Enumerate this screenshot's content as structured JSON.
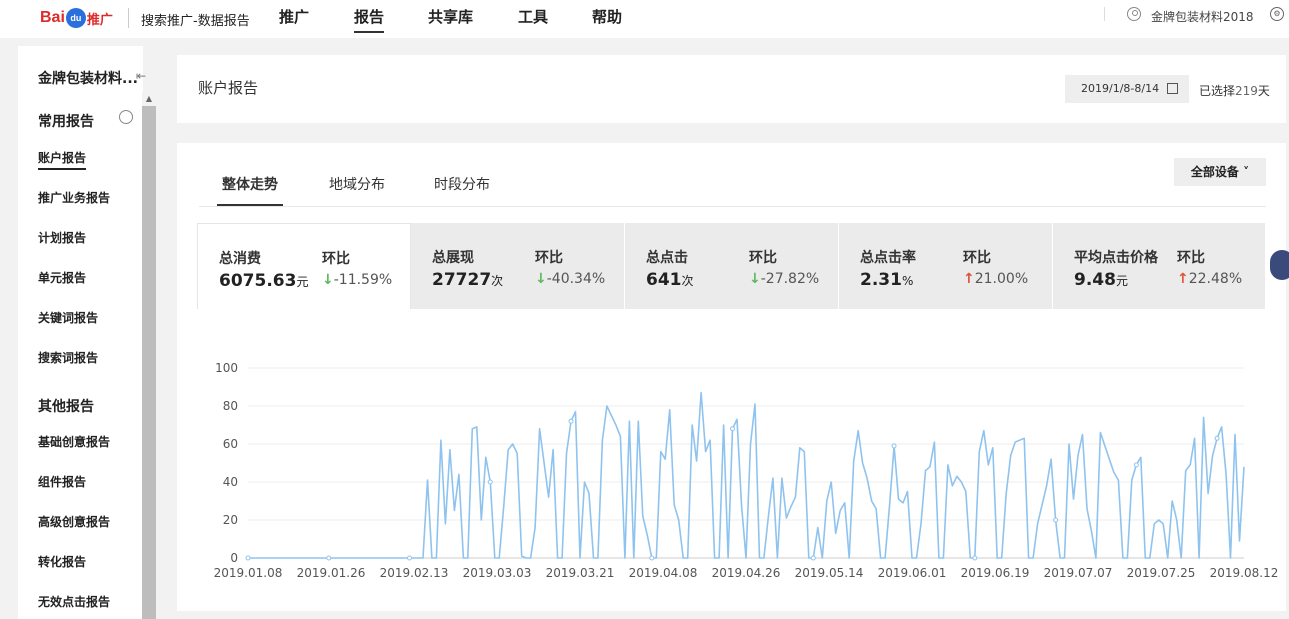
{
  "header": {
    "logo_bai": "Bai",
    "logo_du": "du",
    "logo_suffix": "推广",
    "app_title": "搜索推广-数据报告",
    "nav": [
      "推广",
      "报告",
      "共享库",
      "工具",
      "帮助"
    ],
    "active_nav": "报告",
    "user_name": "金牌包装材料2018"
  },
  "sidebar": {
    "account": "金牌包装材料...",
    "group_common": "常用报告",
    "common_items": [
      "账户报告",
      "推广业务报告",
      "计划报告",
      "单元报告",
      "关键词报告",
      "搜索词报告"
    ],
    "group_other": "其他报告",
    "other_items": [
      "基础创意报告",
      "组件报告",
      "高级创意报告",
      "转化报告",
      "无效点击报告"
    ]
  },
  "report": {
    "title": "账户报告",
    "date_range": "2019/1/8-8/14",
    "selected_prefix": "已选择",
    "selected_days": "219",
    "selected_suffix": "天"
  },
  "tabs": [
    "整体走势",
    "地域分布",
    "时段分布"
  ],
  "device_filter": "全部设备",
  "metrics": [
    {
      "label": "总消费",
      "value": "6075.63",
      "unit": "元",
      "cmp_label": "环比",
      "cmp": "-11.59%",
      "dir": "down"
    },
    {
      "label": "总展现",
      "value": "27727",
      "unit": "次",
      "cmp_label": "环比",
      "cmp": "-40.34%",
      "dir": "down"
    },
    {
      "label": "总点击",
      "value": "641",
      "unit": "次",
      "cmp_label": "环比",
      "cmp": "-27.82%",
      "dir": "down"
    },
    {
      "label": "总点击率",
      "value": "2.31",
      "unit": "%",
      "cmp_label": "环比",
      "cmp": "21.00%",
      "dir": "up"
    },
    {
      "label": "平均点击价格",
      "value": "9.48",
      "unit": "元",
      "cmp_label": "环比",
      "cmp": "22.48%",
      "dir": "up"
    }
  ],
  "colors": {
    "line": "#8fc3ef",
    "down_arrow": "#5cb85c",
    "up_arrow": "#e0533a"
  },
  "chart_data": {
    "type": "line",
    "ylim": [
      0,
      100
    ],
    "yticks": [
      0,
      20,
      40,
      60,
      80,
      100
    ],
    "xtick_labels": [
      "2019.01.08",
      "2019.01.26",
      "2019.02.13",
      "2019.03.03",
      "2019.03.21",
      "2019.04.08",
      "2019.04.26",
      "2019.05.14",
      "2019.06.01",
      "2019.06.19",
      "2019.07.07",
      "2019.07.25",
      "2019.08.12"
    ],
    "series": [
      {
        "values": [
          0,
          0,
          0,
          0,
          0,
          0,
          0,
          0,
          0,
          0,
          0,
          0,
          0,
          0,
          0,
          0,
          0,
          0,
          0,
          0,
          0,
          0,
          0,
          0,
          0,
          0,
          0,
          0,
          0,
          0,
          0,
          0,
          0,
          0,
          0,
          0,
          0,
          0,
          0,
          0,
          41,
          0,
          0,
          62,
          18,
          57,
          25,
          44,
          0,
          0,
          68,
          69,
          20,
          53,
          40,
          0,
          0,
          27,
          57,
          60,
          55,
          1,
          0,
          0,
          16,
          68,
          50,
          32,
          57,
          0,
          0,
          55,
          72,
          77,
          0,
          40,
          34,
          0,
          0,
          62,
          80,
          75,
          70,
          64,
          0,
          72,
          0,
          72,
          22,
          12,
          0,
          0,
          56,
          52,
          78,
          28,
          20,
          0,
          0,
          70,
          51,
          87,
          56,
          62,
          0,
          0,
          70,
          0,
          68,
          73,
          28,
          0,
          60,
          81,
          0,
          0,
          22,
          42,
          0,
          42,
          21,
          27,
          32,
          58,
          56,
          0,
          0,
          16,
          0,
          30,
          40,
          13,
          25,
          29,
          0,
          51,
          67,
          50,
          42,
          30,
          26,
          0,
          0,
          28,
          59,
          31,
          29,
          35,
          0,
          0,
          18,
          46,
          48,
          61,
          0,
          0,
          49,
          38,
          43,
          40,
          35,
          0,
          0,
          56,
          67,
          49,
          58,
          0,
          0,
          34,
          54,
          61,
          62,
          63,
          0,
          0,
          18,
          28,
          38,
          52,
          20,
          0,
          0,
          60,
          31,
          54,
          65,
          26,
          14,
          0,
          66,
          59,
          52,
          45,
          41,
          0,
          0,
          41,
          49,
          53,
          0,
          0,
          18,
          20,
          18,
          0,
          30,
          20,
          0,
          46,
          49,
          63,
          0,
          74,
          34,
          54,
          63,
          69,
          44,
          0,
          65,
          9,
          48
        ]
      }
    ]
  }
}
